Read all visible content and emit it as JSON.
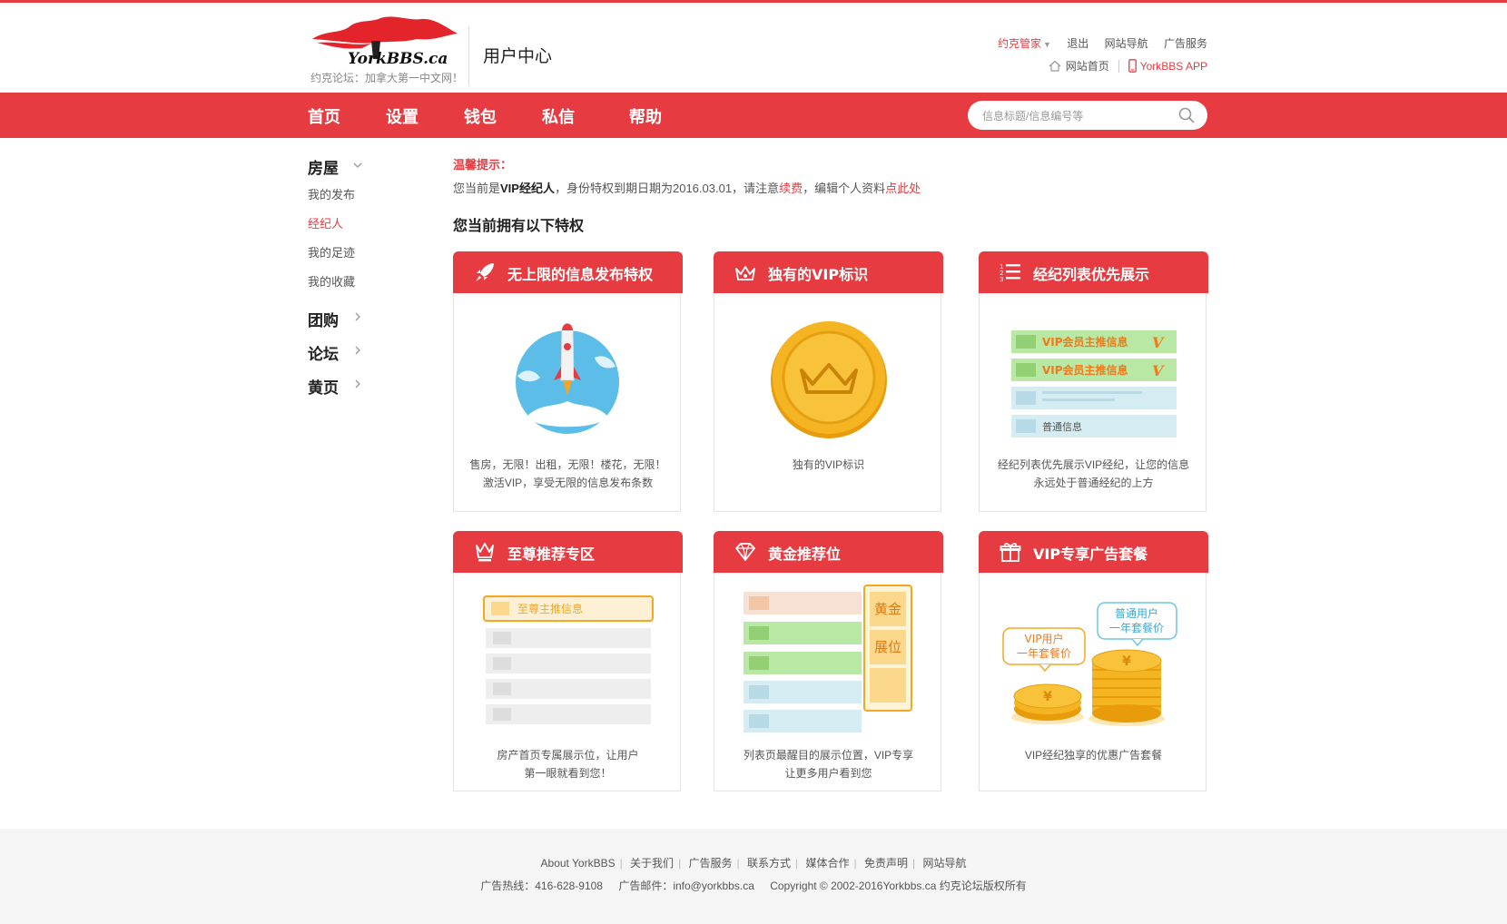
{
  "header": {
    "logo_text": "YorkBBS.ca",
    "tagline": "约克论坛：加拿大第一中文网！",
    "title": "用户中心",
    "top_links": [
      {
        "label": "约克管家",
        "accent": true
      },
      {
        "label": "退出"
      },
      {
        "label": "网站导航"
      },
      {
        "label": "广告服务"
      }
    ],
    "home_link": "网站首页",
    "app_link": "YorkBBS APP"
  },
  "nav": {
    "items": [
      "首页",
      "设置",
      "钱包",
      "私信",
      "帮助"
    ],
    "search_placeholder": "信息标题/信息编号等"
  },
  "sidebar": {
    "house": {
      "label": "房屋",
      "items": [
        "我的发布",
        "经纪人",
        "我的足迹",
        "我的收藏"
      ],
      "active": "经纪人"
    },
    "groups": [
      "团购",
      "论坛",
      "黄页"
    ]
  },
  "notice": {
    "title": "温馨提示：",
    "part1": "您当前是",
    "vip": "VIP经纪人",
    "part2": "，身份特权到期日期为2016.03.01，请注意",
    "renew": "续费",
    "part3": "，编辑个人资料",
    "click": "点此处"
  },
  "privileges_title": "您当前拥有以下特权",
  "cards": [
    {
      "title": "无上限的信息发布特权",
      "icon": "rocket-icon",
      "desc1": "售房，无限！出租，无限！楼花，无限！",
      "desc2": "激活VIP，享受无限的信息发布条数"
    },
    {
      "title": "独有的VIP标识",
      "icon": "crown-icon",
      "desc1": "独有的VIP标识",
      "desc2": ""
    },
    {
      "title": "经纪列表优先展示",
      "icon": "list-icon",
      "desc1": "经纪列表优先展示VIP经纪，让您的信息",
      "desc2": "永远处于普通经纪的上方",
      "art": {
        "vip_label": "VIP会员主推信息",
        "normal_label": "普通信息",
        "badge": "V"
      }
    },
    {
      "title": "至尊推荐专区",
      "icon": "crown-outline-icon",
      "desc1": "房产首页专属展示位，让用户",
      "desc2": "第一眼就看到您！",
      "art": {
        "label": "至尊主推信息"
      }
    },
    {
      "title": "黄金推荐位",
      "icon": "diamond-icon",
      "desc1": "列表页最醒目的展示位置，VIP专享",
      "desc2": "让更多用户看到您",
      "art": {
        "label1": "黄金",
        "label2": "展位"
      }
    },
    {
      "title": "VIP专享广告套餐",
      "icon": "gift-icon",
      "desc1": "VIP经纪独享的优惠广告套餐",
      "desc2": "",
      "art": {
        "vip_bubble1": "VIP用户",
        "vip_bubble2": "一年套餐价",
        "normal_bubble1": "普通用户",
        "normal_bubble2": "一年套餐价",
        "coin_symbol": "¥"
      }
    }
  ],
  "footer": {
    "links": [
      "About YorkBBS",
      "关于我们",
      "广告服务",
      "联系方式",
      "媒体合作",
      "免责声明",
      "网站导航"
    ],
    "hotline": "广告热线：416-628-9108",
    "email": "广告邮件：info@yorkbbs.ca",
    "copyright": "Copyright © 2002-2016Yorkbbs.ca 约克论坛版权所有"
  },
  "colors": {
    "accent": "#e63c41",
    "gold": "#f5b522",
    "footer_bg": "#f5f5f5"
  }
}
